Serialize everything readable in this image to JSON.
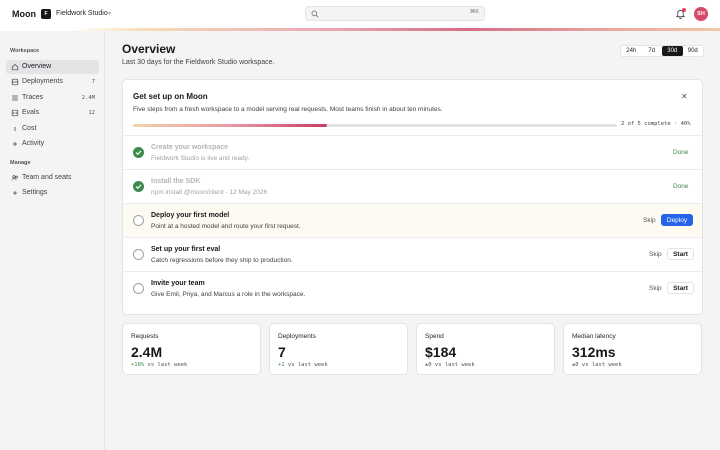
{
  "header": {
    "brand": "Moon",
    "workspace_initial": "F",
    "workspace_name": "Fieldwork Studio",
    "search_placeholder": "",
    "search_shortcut": "⌘K",
    "user_initials": "SH",
    "accent_color": "#d56d86"
  },
  "sidebar": {
    "workspace_heading": "Workspace",
    "manage_heading": "Manage",
    "items": [
      {
        "label": "Overview",
        "icon": "home-icon",
        "count": ""
      },
      {
        "label": "Deployments",
        "icon": "layers-icon",
        "count": "7"
      },
      {
        "label": "Traces",
        "icon": "list-icon",
        "count": "2.4M"
      },
      {
        "label": "Evals",
        "icon": "code-icon",
        "count": "12"
      },
      {
        "label": "Cost",
        "icon": "dollar-icon",
        "count": ""
      },
      {
        "label": "Activity",
        "icon": "plus-icon",
        "count": ""
      }
    ],
    "manage_items": [
      {
        "label": "Team and seats",
        "icon": "users-icon"
      },
      {
        "label": "Settings",
        "icon": "plus-icon"
      }
    ]
  },
  "main": {
    "title": "Overview",
    "subtitle": "Last 30 days for the Fieldwork Studio workspace.",
    "ranges": [
      "24h",
      "7d",
      "30d",
      "90d"
    ],
    "selected_range": "30d"
  },
  "setup": {
    "title": "Get set up on Moon",
    "subtitle": "Five steps from a fresh workspace to a model serving real requests. Most teams finish in about ten minutes.",
    "progress_fraction": 0.4,
    "progress_label": "2 of 5 complete · 40%",
    "steps": [
      {
        "title": "Create your workspace",
        "desc": "Fieldwork Studio is live and ready.",
        "status": "done",
        "action": "Done"
      },
      {
        "title": "Install the SDK",
        "desc": "npm install @moon/client · 12 May 2026",
        "status": "done",
        "action": "Done"
      },
      {
        "title": "Deploy your first model",
        "desc": "Point at a hosted model and route your first request.",
        "status": "current",
        "skip": "Skip",
        "action": "Deploy"
      },
      {
        "title": "Set up your first eval",
        "desc": "Catch regressions before they ship to production.",
        "status": "todo",
        "skip": "Skip",
        "action": "Start"
      },
      {
        "title": "Invite your team",
        "desc": "Give Emil, Priya, and Marcus a role in the workspace.",
        "status": "todo",
        "skip": "Skip",
        "action": "Start"
      }
    ]
  },
  "stats": [
    {
      "label": "Requests",
      "value": "2.4M",
      "delta_main": "+18%",
      "delta_rest": " vs last week",
      "positive": true
    },
    {
      "label": "Deployments",
      "value": "7",
      "delta_main": "+1",
      "delta_rest": " vs last week",
      "positive": true
    },
    {
      "label": "Spend",
      "value": "$184",
      "delta_main": "±0",
      "delta_rest": " vs last week",
      "positive": false
    },
    {
      "label": "Median latency",
      "value": "312ms",
      "delta_main": "±0",
      "delta_rest": " vs last week",
      "positive": false
    }
  ]
}
